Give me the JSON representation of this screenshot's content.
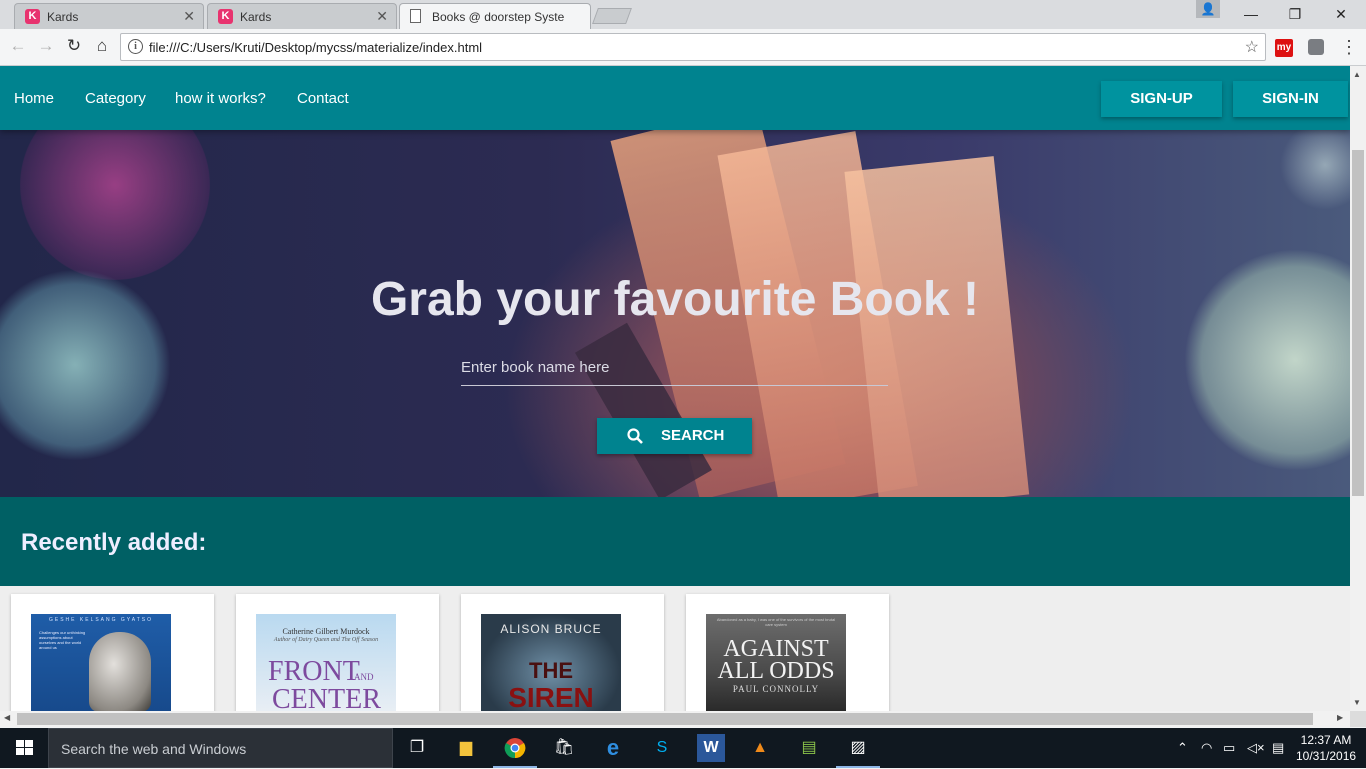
{
  "browser": {
    "tabs": [
      {
        "title": "Kards",
        "favicon": "K"
      },
      {
        "title": "Kards",
        "favicon": "K"
      },
      {
        "title": "Books @ doorstep Syste",
        "favicon": "document-icon"
      }
    ],
    "url": "file:///C:/Users/Kruti/Desktop/mycss/materialize/index.html",
    "extension_label": "my"
  },
  "site": {
    "nav": {
      "links": [
        "Home",
        "Category",
        "how it works?",
        "Contact"
      ],
      "signup_label": "SIGN-UP",
      "signin_label": "SIGN-IN"
    },
    "hero": {
      "headline": "Grab your favourite Book !",
      "search_placeholder": "Enter book name here",
      "search_button": "SEARCH"
    },
    "recent": {
      "heading": "Recently added:",
      "books": [
        {
          "cover_author": "GESHE KELSANG GYATSO",
          "cover_blurb": "Challenges our unthinking assumptions about ourselves and the world around us"
        },
        {
          "cover_author": "Catherine Gilbert Murdock",
          "cover_subtitle": "Author of Dairy Queen and The Off Season",
          "title_top": "FRONT",
          "title_and": "AND",
          "title_bottom": "CENTER"
        },
        {
          "cover_author": "ALISON BRUCE",
          "title_top": "THE",
          "title_bottom": "SIREN"
        },
        {
          "cover_blurb": "Abandoned as a baby, I was one of the survivors of the most brutal care system",
          "title_top": "AGAINST",
          "title_bottom": "ALL ODDS",
          "cover_author": "PAUL CONNOLLY"
        }
      ]
    },
    "colors": {
      "primary": "#00838f",
      "dark": "#006064"
    }
  },
  "taskbar": {
    "search_placeholder": "Search the web and Windows",
    "clock_time": "12:37 AM",
    "clock_date": "10/31/2016"
  }
}
